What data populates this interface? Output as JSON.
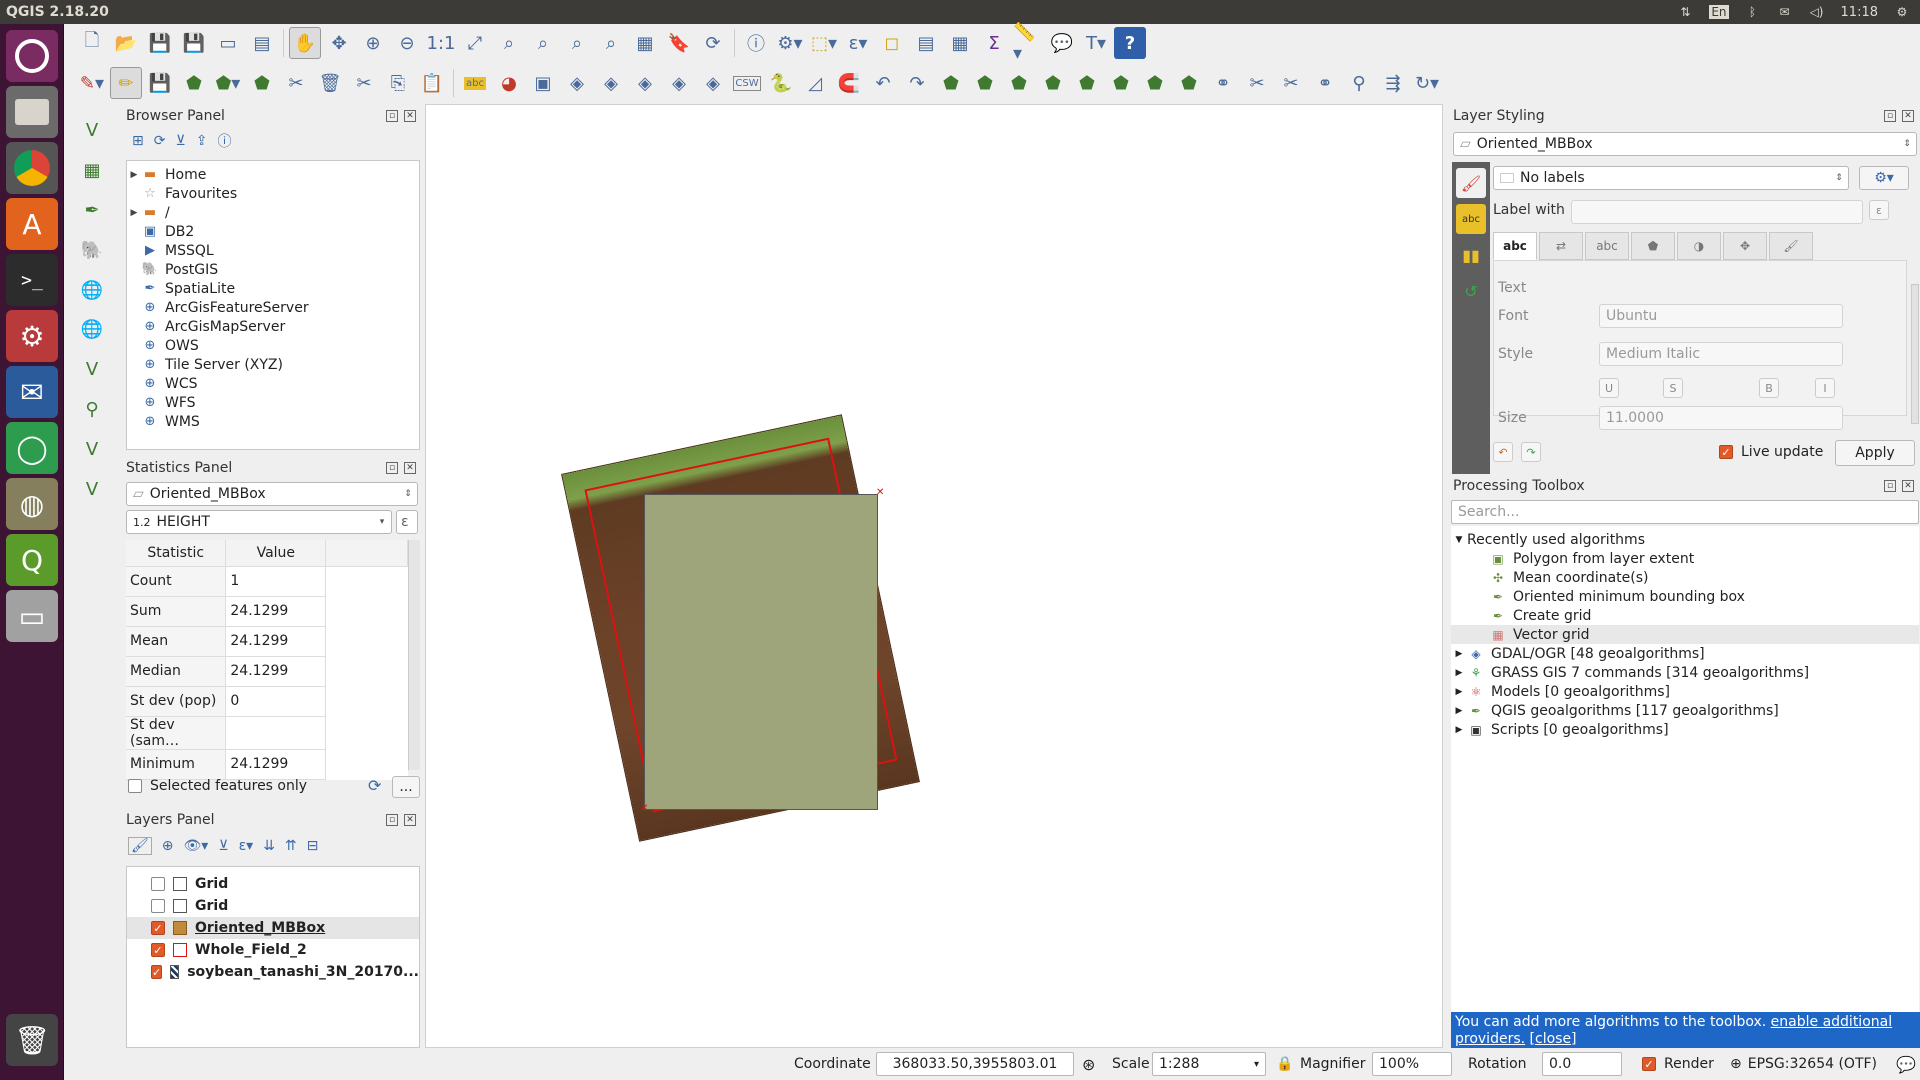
{
  "app": {
    "title": "QGIS 2.18.20"
  },
  "tray": {
    "keyboard": "En",
    "time": "11:18"
  },
  "browser_panel": {
    "title": "Browser Panel",
    "items": [
      {
        "label": "Home",
        "expandable": true,
        "icon": "folder-icon"
      },
      {
        "label": "Favourites",
        "expandable": false,
        "icon": "star-icon"
      },
      {
        "label": "/",
        "expandable": true,
        "icon": "folder-icon"
      },
      {
        "label": "DB2",
        "expandable": false,
        "icon": "db2-icon"
      },
      {
        "label": "MSSQL",
        "expandable": false,
        "icon": "mssql-icon"
      },
      {
        "label": "PostGIS",
        "expandable": false,
        "icon": "postgis-icon"
      },
      {
        "label": "SpatiaLite",
        "expandable": false,
        "icon": "spatialite-icon"
      },
      {
        "label": "ArcGisFeatureServer",
        "expandable": false,
        "icon": "globe-icon"
      },
      {
        "label": "ArcGisMapServer",
        "expandable": false,
        "icon": "globe-icon"
      },
      {
        "label": "OWS",
        "expandable": false,
        "icon": "globe-icon"
      },
      {
        "label": "Tile Server (XYZ)",
        "expandable": false,
        "icon": "globe-icon"
      },
      {
        "label": "WCS",
        "expandable": false,
        "icon": "globe-icon"
      },
      {
        "label": "WFS",
        "expandable": false,
        "icon": "globe-icon"
      },
      {
        "label": "WMS",
        "expandable": false,
        "icon": "globe-icon"
      }
    ]
  },
  "statistics_panel": {
    "title": "Statistics Panel",
    "layer": "Oriented_MBBox",
    "field": "HEIGHT",
    "field_type": "1.2",
    "columns": [
      "Statistic",
      "Value"
    ],
    "rows": [
      {
        "k": "Count",
        "v": "1"
      },
      {
        "k": "Sum",
        "v": "24.1299"
      },
      {
        "k": "Mean",
        "v": "24.1299"
      },
      {
        "k": "Median",
        "v": "24.1299"
      },
      {
        "k": "St dev (pop)",
        "v": "0"
      },
      {
        "k": "St dev (sam…",
        "v": ""
      },
      {
        "k": "Minimum",
        "v": "24.1299"
      }
    ],
    "selected_only": "Selected features only",
    "more": "..."
  },
  "layers_panel": {
    "title": "Layers Panel",
    "layers": [
      {
        "name": "Grid",
        "visible": false,
        "selected": false
      },
      {
        "name": "Grid",
        "visible": false,
        "selected": false
      },
      {
        "name": "Oriented_MBBox",
        "visible": true,
        "selected": true
      },
      {
        "name": "Whole_Field_2",
        "visible": true,
        "selected": false
      },
      {
        "name": "soybean_tanashi_3N_20170...",
        "visible": true,
        "selected": false
      }
    ]
  },
  "layer_styling": {
    "title": "Layer Styling",
    "layer": "Oriented_MBBox",
    "labels_mode": "No labels",
    "label_with": "Label with",
    "tab_text": "abc",
    "section": "Text",
    "font_label": "Font",
    "font_value": "Ubuntu",
    "style_label": "Style",
    "style_value": "Medium Italic",
    "size_label": "Size",
    "size_value": "11.0000",
    "fmt": [
      "U",
      "S",
      "B",
      "I"
    ],
    "live_update": "Live update",
    "apply": "Apply"
  },
  "processing": {
    "title": "Processing Toolbox",
    "search_placeholder": "Search...",
    "recent_header": "Recently used algorithms",
    "recent": [
      "Polygon from layer extent",
      "Mean coordinate(s)",
      "Oriented minimum bounding box",
      "Create grid",
      "Vector grid"
    ],
    "providers": [
      "GDAL/OGR [48 geoalgorithms]",
      "GRASS GIS 7 commands [314 geoalgorithms]",
      "Models [0 geoalgorithms]",
      "QGIS geoalgorithms [117 geoalgorithms]",
      "Scripts [0 geoalgorithms]"
    ],
    "banner_text": "You can add more algorithms to the toolbox.",
    "banner_link": "enable additional providers.",
    "banner_close": "[close]"
  },
  "statusbar": {
    "coordinate_label": "Coordinate",
    "coordinate": "368033.50,3955803.01",
    "scale_label": "Scale",
    "scale": "1:288",
    "magnifier_label": "Magnifier",
    "magnifier": "100%",
    "rotation_label": "Rotation",
    "rotation": "0.0",
    "render": "Render",
    "crs": "EPSG:32654 (OTF)"
  },
  "toolbar": {
    "csw": "CSW",
    "abc": "abc"
  }
}
